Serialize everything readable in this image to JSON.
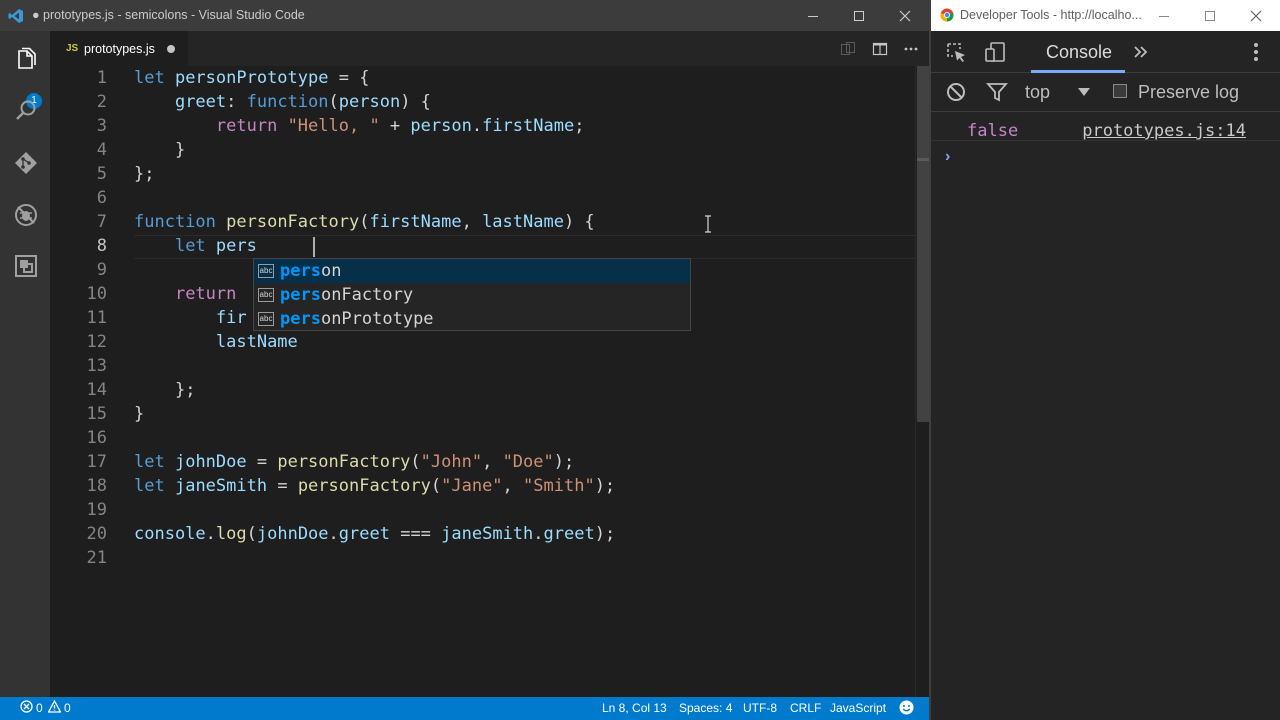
{
  "vscode": {
    "window_title": "● prototypes.js - semicolons - Visual Studio Code",
    "activity_badge": "1",
    "tab": {
      "icon_text": "JS",
      "label": "prototypes.js"
    },
    "line_numbers": [
      "1",
      "2",
      "3",
      "4",
      "5",
      "6",
      "7",
      "8",
      "9",
      "10",
      "11",
      "12",
      "13",
      "14",
      "15",
      "16",
      "17",
      "18",
      "19",
      "20",
      "21"
    ],
    "suggestions": [
      {
        "match": "pers",
        "rest": "on",
        "icon_text": "abc",
        "selected": true
      },
      {
        "match": "pers",
        "rest": "onFactory",
        "icon_text": "abc",
        "selected": false
      },
      {
        "match": "pers",
        "rest": "onPrototype",
        "icon_text": "abc",
        "selected": false
      }
    ],
    "status": {
      "errors": "0",
      "warnings": "0",
      "position": "Ln 8, Col 13",
      "spaces": "Spaces: 4",
      "encoding": "UTF-8",
      "eol": "CRLF",
      "language": "JavaScript"
    }
  },
  "code": {
    "l1_kw": "let",
    "l1_name": " personPrototype",
    "l1_rest": " = {",
    "l2_prop": "greet",
    "l2_colon": ": ",
    "l2_kw": "function",
    "l2_open": "(",
    "l2_param": "person",
    "l2_close": ") {",
    "l3_ret": "return",
    "l3_str": "\"Hello, \"",
    "l3_plus": " + ",
    "l3_obj": "person",
    "l3_dot": ".",
    "l3_prop": "firstName",
    "l3_end": ";",
    "l4": "}",
    "l5": "};",
    "l7_kw": "function",
    "l7_fn": "personFactory",
    "l7_open": "(",
    "l7_p1": "firstName",
    "l7_comma": ", ",
    "l7_p2": "lastName",
    "l7_close": ") {",
    "l8_kw": "let",
    "l8_name": "pers",
    "l10_ret": "return",
    "l11_text": "fir",
    "l12_text": "lastName",
    "l14": "};",
    "l15": "}",
    "l17_kw": "let",
    "l17_name": "johnDoe",
    "l17_eq": " = ",
    "l17_fn": "personFactory",
    "l17_open": "(",
    "l17_s1": "\"John\"",
    "l17_comma": ", ",
    "l17_s2": "\"Doe\"",
    "l17_end": ");",
    "l18_kw": "let",
    "l18_name": "janeSmith",
    "l18_eq": " = ",
    "l18_fn": "personFactory",
    "l18_open": "(",
    "l18_s1": "\"Jane\"",
    "l18_comma": ", ",
    "l18_s2": "\"Smith\"",
    "l18_end": ");",
    "l20_obj": "console",
    "l20_dot1": ".",
    "l20_fn": "log",
    "l20_open": "(",
    "l20_a": "johnDoe",
    "l20_dot2": ".",
    "l20_b": "greet",
    "l20_op": " === ",
    "l20_c": "janeSmith",
    "l20_dot3": ".",
    "l20_d": "greet",
    "l20_end": ");"
  },
  "devtools": {
    "window_title": "Developer Tools - http://localho...",
    "tab_console": "Console",
    "context": "top",
    "preserve_log": "Preserve log",
    "log_value": "false",
    "log_source": "prototypes.js:14",
    "prompt": "›"
  },
  "colors": {
    "accent": "#007acc",
    "keyword": "#569cd6",
    "control": "#c586c0",
    "function": "#dcdcaa",
    "variable": "#9cdcfe",
    "string": "#ce9178"
  }
}
